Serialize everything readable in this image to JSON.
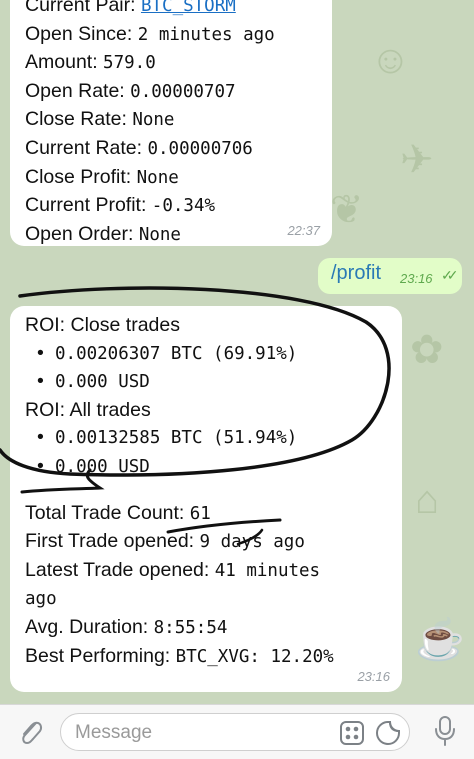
{
  "status_message": {
    "rows": [
      {
        "label": "Current Pair:",
        "value": "BTC_STORM",
        "link": true
      },
      {
        "label": "Open Since:",
        "value": "2 minutes ago"
      },
      {
        "label": "Amount:",
        "value": "579.0"
      },
      {
        "label": "Open Rate:",
        "value": "0.00000707"
      },
      {
        "label": "Close Rate:",
        "value": "None"
      },
      {
        "label": "Current Rate:",
        "value": "0.00000706"
      },
      {
        "label": "Close Profit:",
        "value": "None"
      },
      {
        "label": "Current Profit:",
        "value": "-0.34%"
      },
      {
        "label": "Open Order:",
        "value": "None"
      }
    ],
    "time": "22:37"
  },
  "outgoing": {
    "text": "/profit",
    "time": "23:16",
    "status": "read-double-check"
  },
  "profit_message": {
    "roi_close_label": "ROI:",
    "roi_close_text": "Close trades",
    "roi_close_btc": "0.00206307 BTC (69.91%)",
    "roi_close_usd": "0.000 USD",
    "roi_all_label": "ROI:",
    "roi_all_text": "All trades",
    "roi_all_btc": "0.00132585 BTC (51.94%)",
    "roi_all_usd": "0.000 USD",
    "total_trade_label": "Total Trade Count:",
    "total_trade_value": "61",
    "first_trade_label": "First Trade opened:",
    "first_trade_value": "9 days ago",
    "latest_trade_label": "Latest Trade opened:",
    "latest_trade_value": "41 minutes",
    "latest_trade_value_cont": "ago",
    "avg_duration_label": "Avg. Duration:",
    "avg_duration_value": "8:55:54",
    "best_label": "Best Performing:",
    "best_value": "BTC_XVG: 12.20%",
    "time": "23:16"
  },
  "composer": {
    "placeholder": "Message"
  },
  "bullet": "•",
  "colors": {
    "background": "#c9d7bd",
    "outgoing_bubble": "#e2fdc8",
    "link": "#1a6fc4"
  }
}
